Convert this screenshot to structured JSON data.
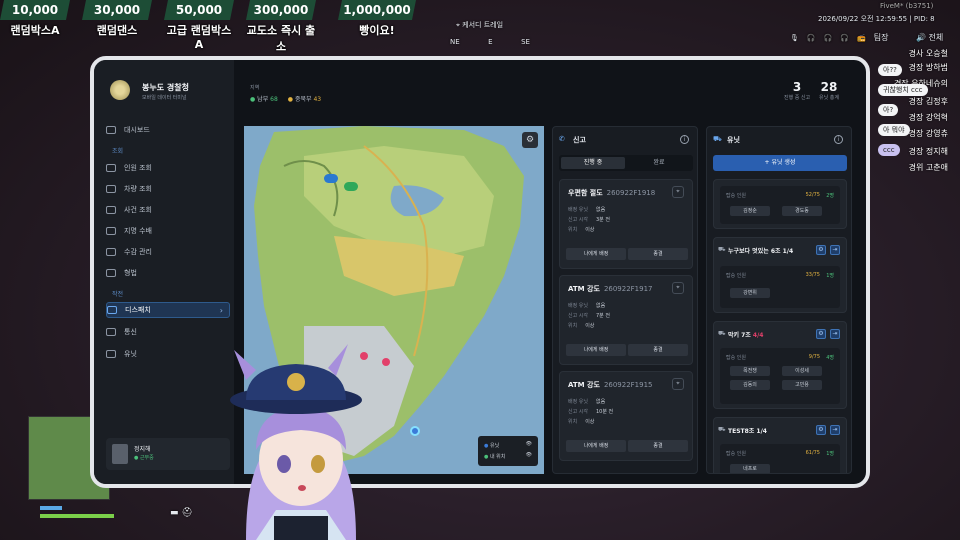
{
  "top_tiers": [
    {
      "amount": "10,000",
      "name": "랜덤박스A"
    },
    {
      "amount": "30,000",
      "name": "랜덤댄스"
    },
    {
      "amount": "50,000",
      "name": "고급 랜덤박스A"
    },
    {
      "amount": "300,000",
      "name": "교도소 즉시 출소"
    },
    {
      "amount": "1,000,000",
      "name": "빵이요!"
    }
  ],
  "hud": {
    "location": "케서디 트레일",
    "compass": [
      "NE",
      "E",
      "SE"
    ],
    "datetime": "2026/09/22 오전 12:59:55 | PID: 8",
    "fivem_tag": "FiveM* (b3751)",
    "radio_label": "팀장",
    "all_label": "전체"
  },
  "sidebar": {
    "title": "봉누도 경찰청",
    "subtitle": "모바일 데이터 터미널",
    "dashboard": "대시보드",
    "section_lookup": "조회",
    "lookup_items": [
      "인원 조회",
      "차량 조회",
      "사건 조회",
      "지명 수배",
      "수감 관리",
      "형법"
    ],
    "section_ops": "작전",
    "ops_items": [
      "디스패치",
      "통신",
      "유닛"
    ],
    "user_name": "정지해",
    "user_status": "● 근무중"
  },
  "header": {
    "small_label": "지역",
    "south_label": "남부",
    "south_count": "68",
    "north_label": "중북부",
    "north_count": "43",
    "active_count": "3",
    "active_label": "진행 중 신고",
    "units_count": "28",
    "units_label": "유닛 총계"
  },
  "map_legend": {
    "unit": "유닛",
    "my_location": "내 위치"
  },
  "reports": {
    "title": "신고",
    "tab_active": "진행 중",
    "tab_done": "완료",
    "assign_label": "배정 유닛",
    "time_label": "신고 시각",
    "location_label": "위치",
    "assign_btn": "나에게 배정",
    "close_btn": "종결",
    "items": [
      {
        "title": "우편함 절도",
        "code": "260922F1918",
        "assigned": "없음",
        "time": "3분 전",
        "location": "이상"
      },
      {
        "title": "ATM 강도",
        "code": "260922F1917",
        "assigned": "없음",
        "time": "7분 전",
        "location": "이상"
      },
      {
        "title": "ATM 강도",
        "code": "260922F1915",
        "assigned": "없음",
        "time": "10분 전",
        "location": "이상"
      }
    ]
  },
  "units": {
    "title": "유닛",
    "create_btn": "+ 유닛 생성",
    "members_label": "탑승 인원",
    "items": [
      {
        "name": "",
        "frac": "52/75",
        "count": "2명",
        "members": [
          "김정순",
          "경도동"
        ]
      },
      {
        "name": "누구보다 멋있는 6조",
        "count_tag": "1/4",
        "frac": "33/75",
        "count": "1명",
        "members": [
          "강변위"
        ]
      },
      {
        "name": "막키 7조",
        "count_tag": "4/4",
        "frac": "9/75",
        "count": "4명",
        "members": [
          "목전쟁",
          "이성세",
          "김동의",
          "고민용"
        ]
      },
      {
        "name": "TEST8조",
        "count_tag": "1/4",
        "frac": "61/75",
        "count": "1명",
        "members": [
          "네프로"
        ]
      }
    ]
  },
  "chat": {
    "lines": [
      "경사 오승철",
      "경장 방하범",
      "경장 유하네슈의",
      "경장 김정후",
      "경장 강억혁",
      "경장 강영츄",
      "경장 정지해",
      "경위 고춘애"
    ],
    "bubbles": [
      "아??",
      "귀찮행치 ccc",
      "아?",
      "아 뭐야",
      "ccc"
    ]
  },
  "colors": {
    "accent": "#3b7bd8",
    "green": "#4bc07a",
    "amber": "#e3b341",
    "tier_bg": "#1d4d36"
  }
}
